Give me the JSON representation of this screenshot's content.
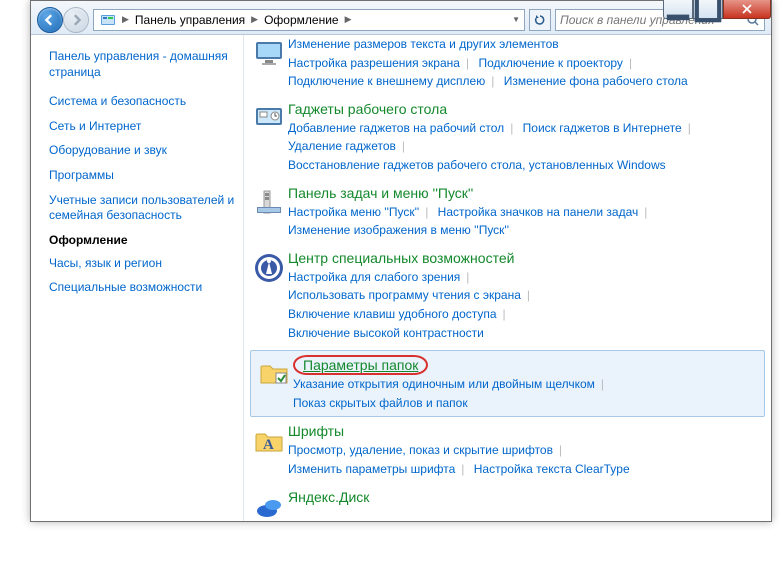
{
  "breadcrumb": {
    "root": "Панель управления",
    "section": "Оформление"
  },
  "search": {
    "placeholder": "Поиск в панели управления"
  },
  "sidebar": {
    "home": "Панель управления - домашняя страница",
    "items": [
      {
        "label": "Система и безопасность"
      },
      {
        "label": "Сеть и Интернет"
      },
      {
        "label": "Оборудование и звук"
      },
      {
        "label": "Программы"
      },
      {
        "label": "Учетные записи пользователей и семейная безопасность"
      },
      {
        "label": "Оформление",
        "active": true
      },
      {
        "label": "Часы, язык и регион"
      },
      {
        "label": "Специальные возможности"
      }
    ]
  },
  "groups": [
    {
      "title": "",
      "links": [
        "Изменение размеров текста и других элементов",
        "Настройка разрешения экрана",
        "Подключение к проектору",
        "Подключение к внешнему дисплею",
        "Изменение фона рабочего стола"
      ]
    },
    {
      "title": "Гаджеты рабочего стола",
      "links": [
        "Добавление гаджетов на рабочий стол",
        "Поиск гаджетов в Интернете",
        "Удаление гаджетов",
        "Восстановление гаджетов рабочего стола, установленных Windows"
      ]
    },
    {
      "title": "Панель задач и меню ''Пуск''",
      "links": [
        "Настройка меню ''Пуск''",
        "Настройка значков на панели задач",
        "Изменение изображения в меню ''Пуск''"
      ]
    },
    {
      "title": "Центр специальных возможностей",
      "links": [
        "Настройка для слабого зрения",
        "Использовать программу чтения с экрана",
        "Включение клавиш удобного доступа",
        "Включение высокой контрастности"
      ]
    },
    {
      "title": "Параметры папок",
      "links": [
        "Указание открытия одиночным или двойным щелчком",
        "Показ скрытых файлов и папок"
      ],
      "highlight": true
    },
    {
      "title": "Шрифты",
      "links": [
        "Просмотр, удаление, показ и скрытие шрифтов",
        "Изменить параметры шрифта",
        "Настройка текста ClearType"
      ]
    },
    {
      "title": "Яндекс.Диск",
      "links": []
    }
  ]
}
